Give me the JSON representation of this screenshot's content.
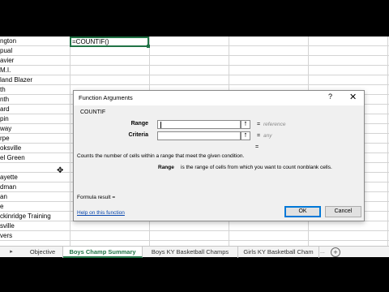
{
  "sheet": {
    "active_cell_text": "=COUNTIF()",
    "rows": [
      "ngton",
      "pual",
      "avier",
      "M.I.",
      "land Blazer",
      "th",
      "nth",
      "ard",
      "pin",
      "way",
      "rpe",
      "oksville",
      "el Green",
      "",
      "ayette",
      "dman",
      "an",
      "e",
      "ckinridge Training",
      "sville",
      "vers"
    ]
  },
  "dialog": {
    "title": "Function Arguments",
    "help_glyph": "?",
    "close_glyph": "✕",
    "function_name": "COUNTIF",
    "args": [
      {
        "label": "Range",
        "value": "",
        "hint": "reference"
      },
      {
        "label": "Criteria",
        "value": "",
        "hint": "any"
      }
    ],
    "equals": "=",
    "collapse_glyph": "⭡",
    "description": "Counts the number of cells within a range that meet the given condition.",
    "arg_desc_name": "Range",
    "arg_desc_text": "is the range of cells from which you want to count nonblank cells.",
    "formula_result_label": "Formula result =",
    "help_link": "Help on this function",
    "ok_label": "OK",
    "cancel_label": "Cancel"
  },
  "tabs": {
    "nav_arrow": "▸",
    "items": [
      "Objective",
      "Boys Champ Summary",
      "Boys KY Basketball Champs",
      "Girls KY Basketball Cham"
    ],
    "active_index": 1,
    "ellipsis": "...",
    "add_glyph": "+"
  },
  "colors": {
    "accent": "#217346",
    "link": "#0645ad",
    "ok_border": "#0078d7"
  }
}
